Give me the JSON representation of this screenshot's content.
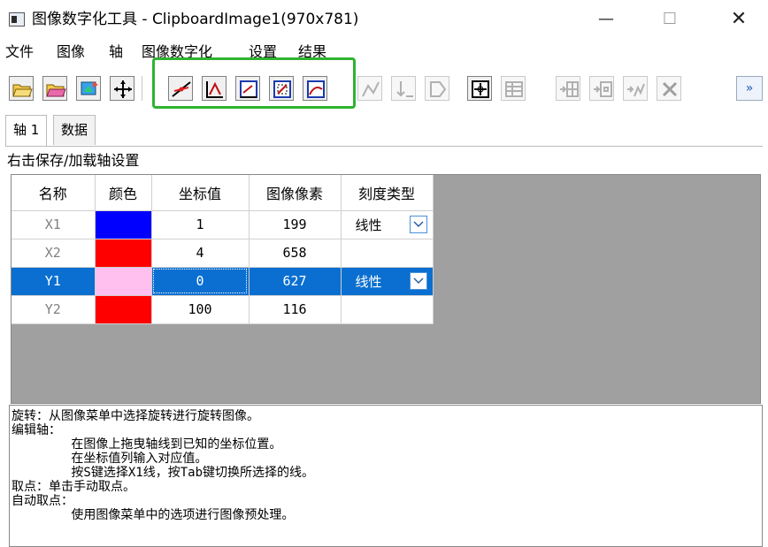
{
  "window": {
    "title": "图像数字化工具 - ClipboardImage1(970x781)",
    "minimize_glyph": "—",
    "maximize_glyph": "☐",
    "close_glyph": "✕"
  },
  "menu": [
    "文件",
    "图像",
    "轴",
    "图像数字化",
    "设置",
    "结果"
  ],
  "toolbar": {
    "buttons": [
      "open-folder-icon",
      "open-image-icon",
      "rotate-icon",
      "move-axis-icon",
      "edit-axis-icon",
      "pick-point-icon",
      "digitize-grid-icon",
      "digitize-box-icon",
      "digitize-region-icon",
      "curve-icon",
      "drop-line-icon",
      "mask-icon",
      "crosshair-icon",
      "table-icon",
      "add-column-icon",
      "add-row-icon",
      "add-curve-icon",
      "delete-icon"
    ],
    "overflow_glyph": "»"
  },
  "tabs": [
    "轴 1",
    "数据"
  ],
  "hint_text": "右击保存/加载轴设置",
  "axis_table": {
    "headers": [
      "名称",
      "颜色",
      "坐标值",
      "图像像素",
      "刻度类型"
    ],
    "rows": [
      {
        "name": "X1",
        "color": "#0000ff",
        "value": "1",
        "pixel": "199",
        "scale": "线性"
      },
      {
        "name": "X2",
        "color": "#ff0000",
        "value": "4",
        "pixel": "658",
        "scale": ""
      },
      {
        "name": "Y1",
        "color": "#ffc0f0",
        "value": "0",
        "pixel": "627",
        "scale": "线性"
      },
      {
        "name": "Y2",
        "color": "#ff0000",
        "value": "100",
        "pixel": "116",
        "scale": ""
      }
    ]
  },
  "help_lines": [
    "旋转：从图像菜单中选择旋转进行旋转图像。",
    "编辑轴：",
    "        在图像上拖曳轴线到已知的坐标位置。",
    "        在坐标值列输入对应值。",
    "        按S键选择X1线，按Tab键切换所选择的线。",
    "取点：单击手动取点。",
    "自动取点：",
    "        使用图像菜单中的选项进行图像预处理。"
  ]
}
